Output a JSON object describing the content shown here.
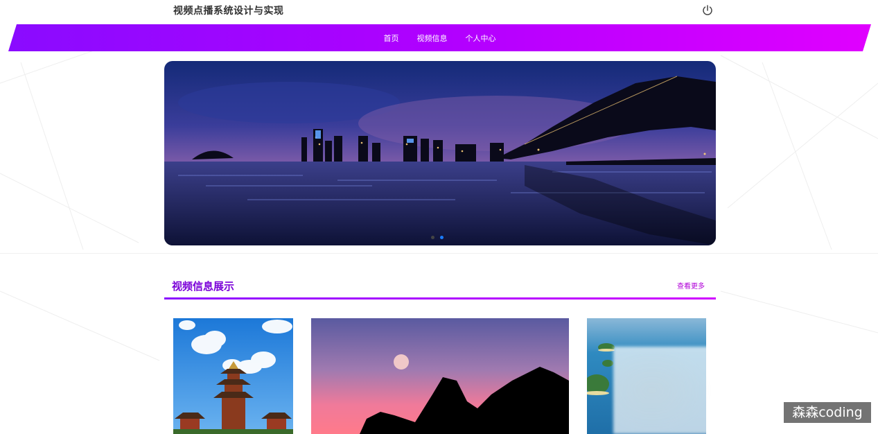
{
  "header": {
    "site_title": "视频点播系统设计与实现",
    "logout_icon": "power-icon"
  },
  "nav": {
    "items": [
      {
        "label": "首页"
      },
      {
        "label": "视频信息"
      },
      {
        "label": "个人中心"
      }
    ],
    "gradient": [
      "#8a0bff",
      "#e000ff"
    ]
  },
  "banner": {
    "scene": "city-skyline-bridge-at-night",
    "dots": 2,
    "active_dot": 1
  },
  "section": {
    "title": "视频信息展示",
    "more_label": "查看更多",
    "accent_color": "#7a00d8"
  },
  "cards": [
    {
      "scene": "pagoda-under-blue-sky"
    },
    {
      "scene": "moon-over-mountain-silhouette-pink-sky"
    },
    {
      "scene": "lake-islands-aerial"
    }
  ],
  "watermark": "森森coding"
}
